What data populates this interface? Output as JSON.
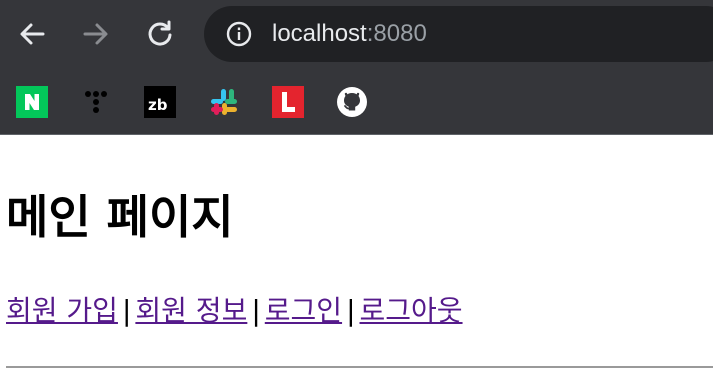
{
  "browser": {
    "url_host": "localhost",
    "url_port": ":8080",
    "colors": {
      "toolbar": "#35363a",
      "omnibox": "#202124",
      "url_text": "#e8eaed",
      "url_port": "#9aa0a6"
    },
    "bookmarks": [
      {
        "name": "naver",
        "icon": "N",
        "color": "#03c75a"
      },
      {
        "name": "tistory",
        "icon": "dots"
      },
      {
        "name": "zerobase",
        "icon": "zb",
        "color": "#000000"
      },
      {
        "name": "slack",
        "icon": "slack"
      },
      {
        "name": "lotte",
        "icon": "L",
        "color": "#e4242e"
      },
      {
        "name": "github",
        "icon": "github"
      }
    ]
  },
  "page": {
    "title": "메인 페이지",
    "links": [
      "회원 가입",
      "회원 정보",
      "로그인",
      "로그아웃"
    ],
    "separator": "|",
    "link_color": "#551a8b"
  }
}
